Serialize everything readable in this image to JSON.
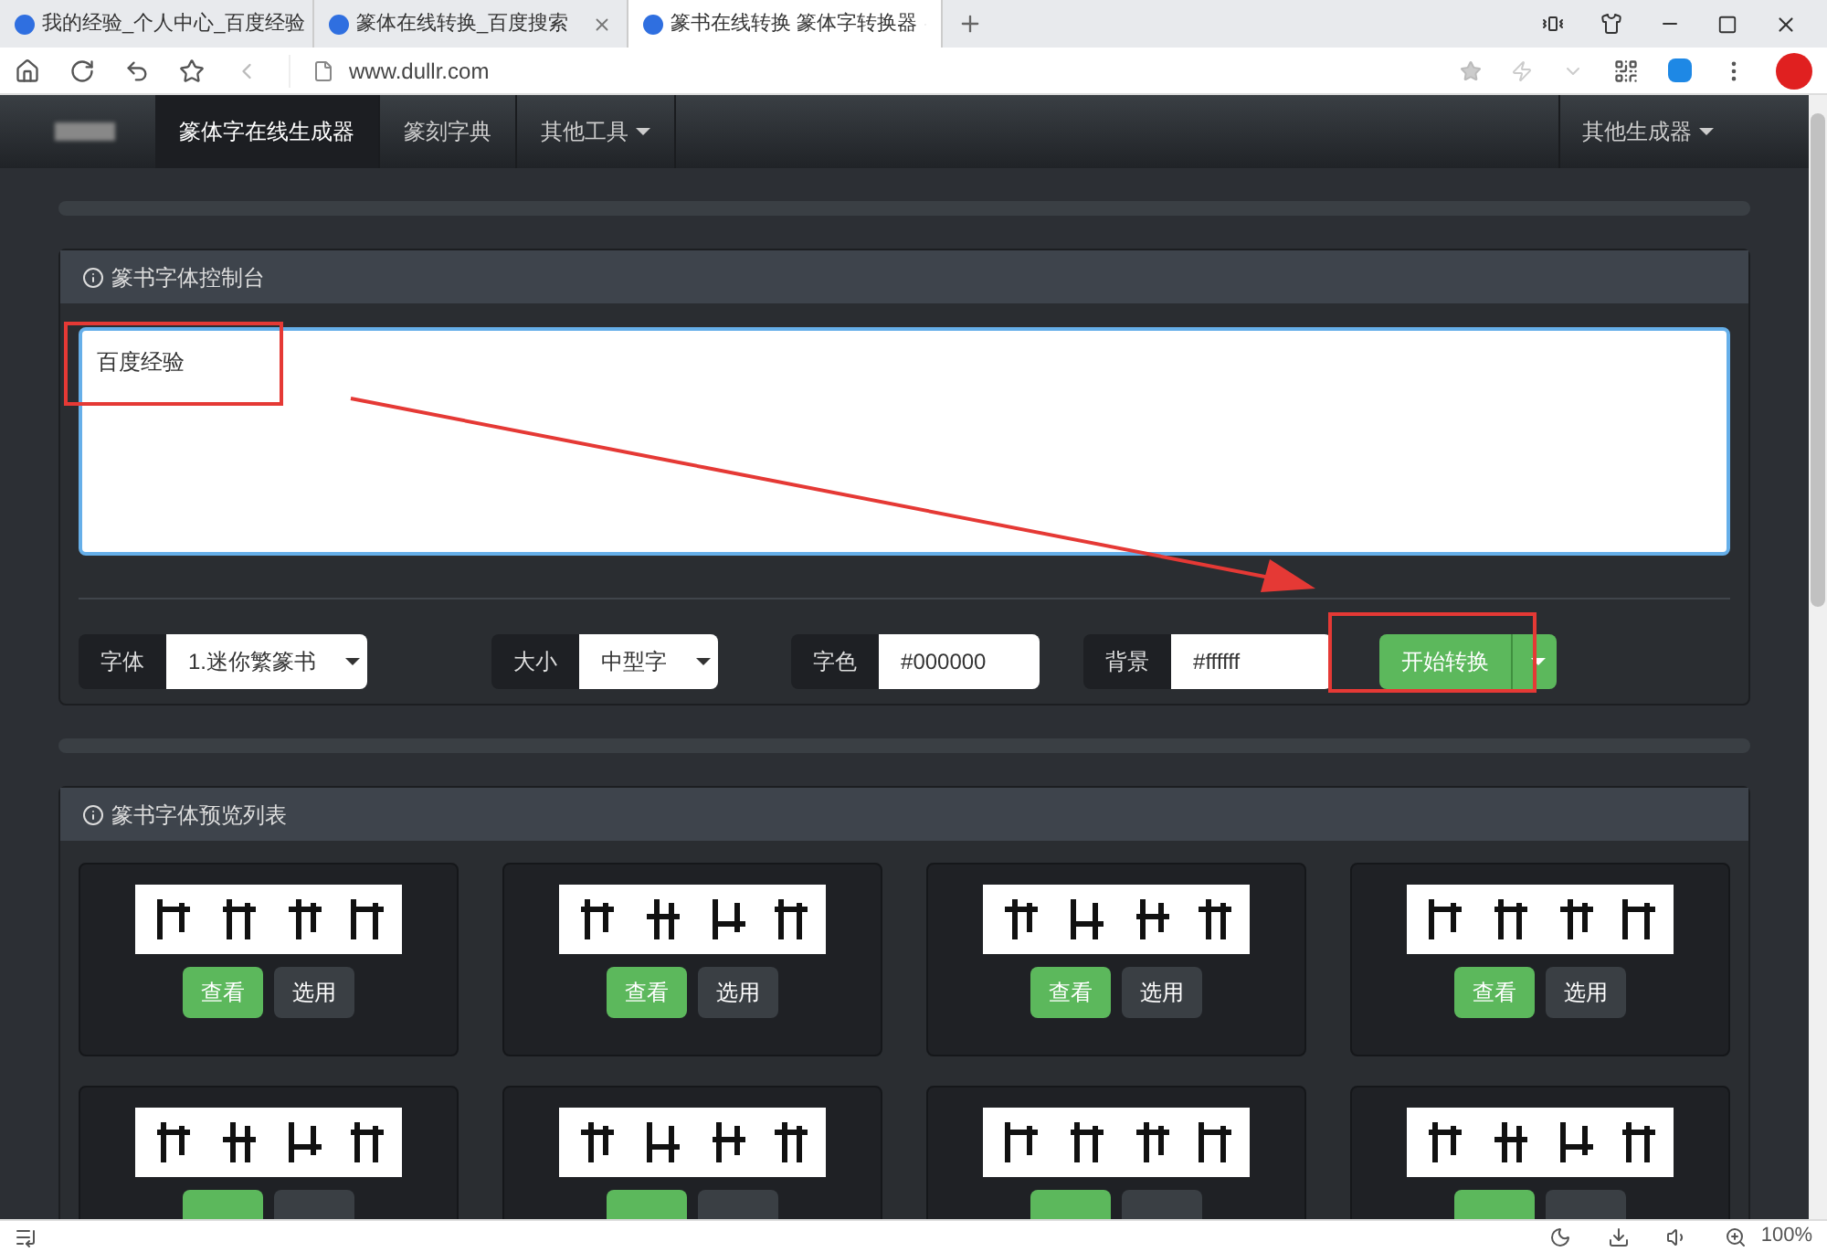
{
  "browser_tabs": [
    {
      "title": "我的经验_个人中心_百度经验",
      "selected": false
    },
    {
      "title": "篆体在线转换_百度搜索",
      "selected": false
    },
    {
      "title": "篆书在线转换 篆体字转换器",
      "selected": true
    }
  ],
  "address": "www.dullr.com",
  "navbar": {
    "items": [
      {
        "label": "篆体字在线生成器",
        "selected": true,
        "dropdown": false
      },
      {
        "label": "篆刻字典",
        "selected": false,
        "dropdown": false
      },
      {
        "label": "其他工具",
        "selected": false,
        "dropdown": true
      }
    ],
    "right_item": {
      "label": "其他生成器",
      "dropdown": true
    }
  },
  "control_panel": {
    "title": "篆书字体控制台",
    "text": "百度经验",
    "font": {
      "label": "字体",
      "value": "1.迷你繁篆书"
    },
    "size": {
      "label": "大小",
      "value": "中型字"
    },
    "color": {
      "label": "字色",
      "value": "#000000"
    },
    "background": {
      "label": "背景",
      "value": "#ffffff"
    },
    "convert_button": "开始转换"
  },
  "preview_panel": {
    "title": "篆书字体预览列表",
    "cards": [
      {
        "kind": "picture",
        "view": "查看",
        "use": "选用"
      },
      {
        "kind": "picture",
        "view": "查看",
        "use": "选用"
      },
      {
        "kind": "picture",
        "view": "查看",
        "use": "选用"
      },
      {
        "kind": "picture",
        "view": "查看",
        "use": "选用"
      },
      {
        "kind": "picture"
      },
      {
        "kind": "picture"
      },
      {
        "kind": "picture"
      },
      {
        "kind": "picture"
      }
    ]
  },
  "status_bar": {
    "zoom": "100%"
  }
}
